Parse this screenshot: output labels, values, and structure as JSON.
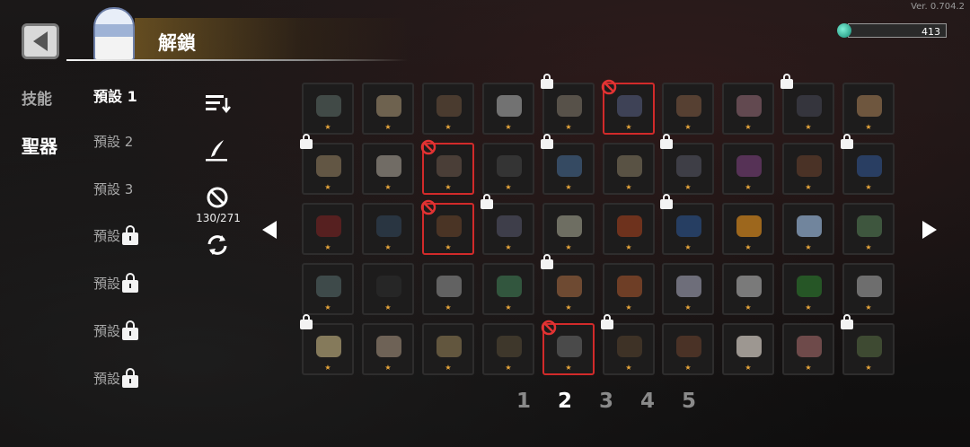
{
  "version": "Ver. 0.704.2",
  "header": {
    "title": "解鎖"
  },
  "currency": {
    "value": "413"
  },
  "tabs": {
    "skill": "技能",
    "relic": "聖器"
  },
  "presets": [
    {
      "label": "預設 1",
      "locked": false,
      "active": true
    },
    {
      "label": "預設 2",
      "locked": false,
      "active": false
    },
    {
      "label": "預設 3",
      "locked": false,
      "active": false
    },
    {
      "label": "預設",
      "locked": true,
      "active": false
    },
    {
      "label": "預設",
      "locked": true,
      "active": false
    },
    {
      "label": "預設",
      "locked": true,
      "active": false
    },
    {
      "label": "預設",
      "locked": true,
      "active": false
    }
  ],
  "tools": {
    "count": "130/271"
  },
  "grid": {
    "rows": [
      [
        {
          "c": "#4e5a55",
          "lock": false,
          "sel": false
        },
        {
          "c": "#8a7960",
          "lock": false,
          "sel": false
        },
        {
          "c": "#5a4636",
          "lock": false,
          "sel": false
        },
        {
          "c": "#8f8f8f",
          "lock": false,
          "sel": false
        },
        {
          "c": "#6b6358",
          "lock": true,
          "sel": false
        },
        {
          "c": "#4a4f6a",
          "lock": false,
          "sel": true
        },
        {
          "c": "#6a4c3a",
          "lock": false,
          "sel": false
        },
        {
          "c": "#7a5862",
          "lock": false,
          "sel": false
        },
        {
          "c": "#3e3e48",
          "lock": true,
          "sel": false
        },
        {
          "c": "#8a6a4a",
          "lock": false,
          "sel": false
        }
      ],
      [
        {
          "c": "#7a6a52",
          "lock": true,
          "sel": false
        },
        {
          "c": "#8d877e",
          "lock": false,
          "sel": false
        },
        {
          "c": "#5a4a40",
          "lock": false,
          "sel": true
        },
        {
          "c": "#3c3c3c",
          "lock": false,
          "sel": false
        },
        {
          "c": "#3e5a7a",
          "lock": true,
          "sel": false
        },
        {
          "c": "#6e6452",
          "lock": false,
          "sel": false
        },
        {
          "c": "#4a4a54",
          "lock": true,
          "sel": false
        },
        {
          "c": "#6a3a6a",
          "lock": false,
          "sel": false
        },
        {
          "c": "#5a3a2a",
          "lock": false,
          "sel": false
        },
        {
          "c": "#2e4a7a",
          "lock": true,
          "sel": false
        }
      ],
      [
        {
          "c": "#6a2222",
          "lock": false,
          "sel": false
        },
        {
          "c": "#2e3e4e",
          "lock": false,
          "sel": false
        },
        {
          "c": "#5a3c28",
          "lock": false,
          "sel": true
        },
        {
          "c": "#4a4a5a",
          "lock": true,
          "sel": false
        },
        {
          "c": "#8a8a7a",
          "lock": false,
          "sel": false
        },
        {
          "c": "#8a3a1e",
          "lock": false,
          "sel": false
        },
        {
          "c": "#2a4a7a",
          "lock": true,
          "sel": false
        },
        {
          "c": "#c8801e",
          "lock": false,
          "sel": false
        },
        {
          "c": "#8ea8c8",
          "lock": false,
          "sel": false
        },
        {
          "c": "#4a6a4a",
          "lock": false,
          "sel": false
        }
      ],
      [
        {
          "c": "#4a5a5a",
          "lock": false,
          "sel": false
        },
        {
          "c": "#2a2a2a",
          "lock": false,
          "sel": false
        },
        {
          "c": "#7a7a7a",
          "lock": false,
          "sel": false
        },
        {
          "c": "#3a6a4a",
          "lock": false,
          "sel": false
        },
        {
          "c": "#8a5a3a",
          "lock": true,
          "sel": false
        },
        {
          "c": "#8a4a2a",
          "lock": false,
          "sel": false
        },
        {
          "c": "#8a8a9a",
          "lock": false,
          "sel": false
        },
        {
          "c": "#9a9a9a",
          "lock": false,
          "sel": false
        },
        {
          "c": "#2a6a2a",
          "lock": false,
          "sel": false
        },
        {
          "c": "#8a8a8a",
          "lock": false,
          "sel": false
        }
      ],
      [
        {
          "c": "#a89a70",
          "lock": true,
          "sel": false
        },
        {
          "c": "#8a7a6a",
          "lock": false,
          "sel": false
        },
        {
          "c": "#7a6a4a",
          "lock": false,
          "sel": false
        },
        {
          "c": "#4a4030",
          "lock": false,
          "sel": false
        },
        {
          "c": "#5a5a5a",
          "lock": false,
          "sel": true
        },
        {
          "c": "#4a3a2a",
          "lock": true,
          "sel": false
        },
        {
          "c": "#5a3a2a",
          "lock": false,
          "sel": false
        },
        {
          "c": "#c8c0b8",
          "lock": false,
          "sel": false
        },
        {
          "c": "#8a5a5a",
          "lock": false,
          "sel": false
        },
        {
          "c": "#4a5a3a",
          "lock": true,
          "sel": false
        }
      ]
    ]
  },
  "pagination": {
    "pages": [
      "1",
      "2",
      "3",
      "4",
      "5"
    ],
    "active": 1
  }
}
